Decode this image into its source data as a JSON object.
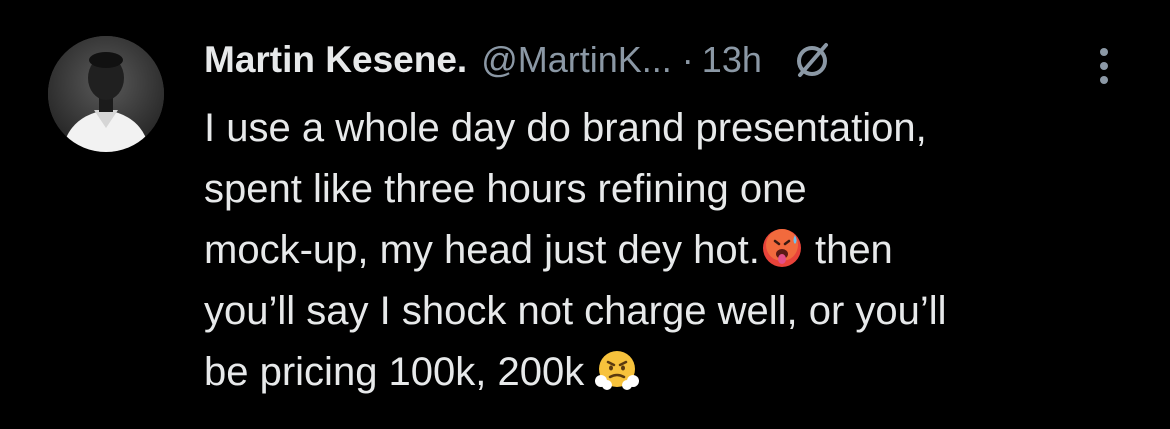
{
  "tweet": {
    "author_name": "Martin Kesene.",
    "author_handle": "@MartinK...",
    "separator": "·",
    "time": "13h",
    "audience_icon": "audience-icon",
    "more_icon": "more-vertical-icon",
    "text_lines": [
      "I use a whole day do brand presentation,",
      "spent like three hours refining one",
      "mock-up, my head just dey hot.",
      "then",
      "you’ll say I shock not charge well, or you’ll",
      "be pricing 100k, 200k"
    ],
    "emojis": [
      "hot-face-emoji",
      "face-with-steam-emoji"
    ]
  },
  "colors": {
    "background": "#000000",
    "text": "#e7e9ea",
    "secondary": "#8b98a5"
  }
}
